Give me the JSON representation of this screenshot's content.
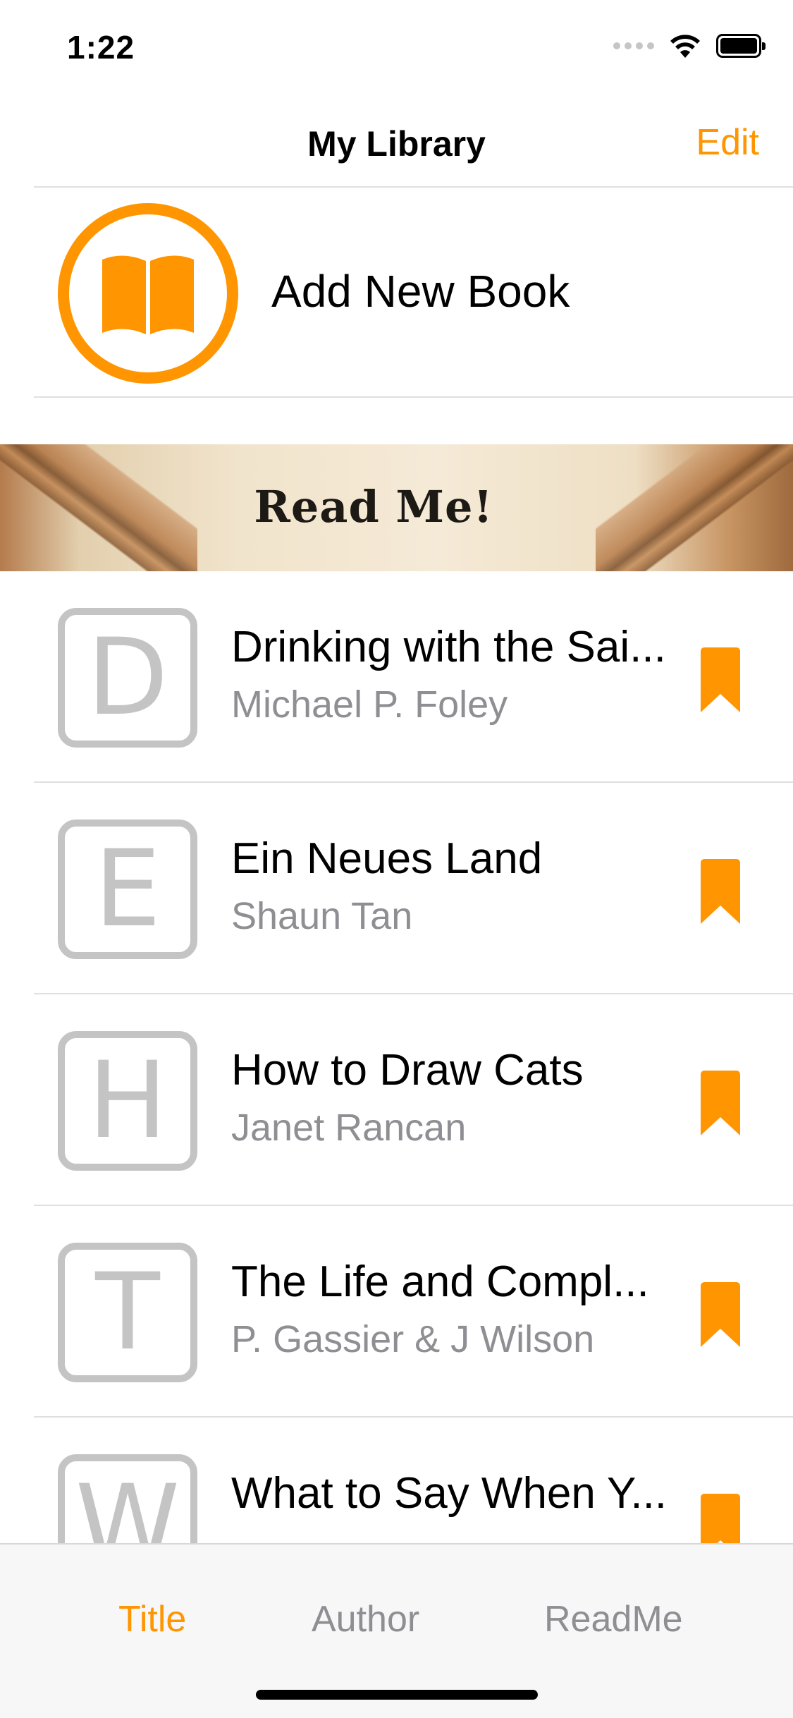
{
  "status_bar": {
    "time": "1:22"
  },
  "nav": {
    "title": "My Library",
    "edit_label": "Edit"
  },
  "add_book": {
    "label": "Add New Book",
    "icon": "open-book-icon"
  },
  "banner": {
    "text": "Read Me!"
  },
  "books": [
    {
      "letter": "D",
      "title": "Drinking with the Sai...",
      "author": "Michael P. Foley",
      "bookmarked": true
    },
    {
      "letter": "E",
      "title": "Ein Neues Land",
      "author": "Shaun Tan",
      "bookmarked": true
    },
    {
      "letter": "H",
      "title": "How to Draw Cats",
      "author": "Janet Rancan",
      "bookmarked": true
    },
    {
      "letter": "T",
      "title": "The Life and Compl...",
      "author": "P. Gassier & J Wilson",
      "bookmarked": true
    },
    {
      "letter": "W",
      "title": "What to Say When Y...",
      "author": "",
      "bookmarked": true
    }
  ],
  "tabs": [
    {
      "label": "Title",
      "active": true
    },
    {
      "label": "Author",
      "active": false
    },
    {
      "label": "ReadMe",
      "active": false
    }
  ],
  "colors": {
    "accent": "#ff9500",
    "secondary_text": "#8e8e93",
    "thumb_border": "#c4c4c4"
  }
}
